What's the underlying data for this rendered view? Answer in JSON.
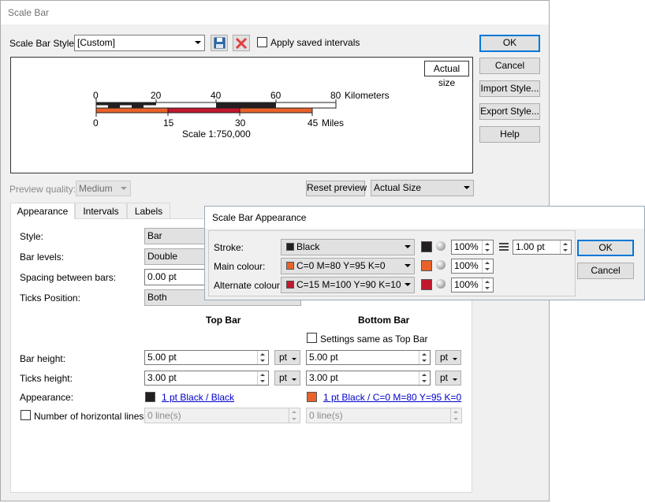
{
  "window": {
    "title": "Scale Bar"
  },
  "style_row": {
    "label": "Scale Bar Style:",
    "value": "[Custom]",
    "apply_saved_label": "Apply saved intervals"
  },
  "side_buttons": {
    "ok": "OK",
    "cancel": "Cancel",
    "import": "Import Style...",
    "export": "Export Style...",
    "help": "Help"
  },
  "preview": {
    "actual_size_tag": "Actual size",
    "km_ticks": [
      "0",
      "20",
      "40",
      "60",
      "80"
    ],
    "km_unit": "Kilometers",
    "mile_ticks": [
      "0",
      "15",
      "30",
      "45"
    ],
    "mile_unit": "Miles",
    "scale_text": "Scale 1:750,000",
    "colors": {
      "black": "#231f20",
      "main": "#e8622a",
      "alternate": "#c0182e"
    }
  },
  "preview_row": {
    "quality_label": "Preview quality:",
    "quality_value": "Medium",
    "reset_label": "Reset preview",
    "size_value": "Actual Size"
  },
  "tabs": [
    "Appearance",
    "Intervals",
    "Labels"
  ],
  "appearance": {
    "style_label": "Style:",
    "style_value": "Bar",
    "levels_label": "Bar levels:",
    "levels_value": "Double",
    "spacing_label": "Spacing between bars:",
    "spacing_value": "0.00 pt",
    "ticks_label": "Ticks Position:",
    "ticks_value": "Both",
    "top_bar_header": "Top Bar",
    "bottom_bar_header": "Bottom Bar",
    "same_settings_label": "Settings same as Top Bar",
    "bar_height_label": "Bar height:",
    "top_bar_height": "5.00 pt",
    "bottom_bar_height": "5.00 pt",
    "ticks_height_label": "Ticks height:",
    "top_ticks_height": "3.00 pt",
    "bottom_ticks_height": "3.00 pt",
    "unit": "pt",
    "appearance_label": "Appearance:",
    "top_appearance_link": "1 pt Black / Black",
    "bottom_appearance_link": "1 pt Black / C=0 M=80 Y=95 K=0",
    "hlines_label": "Number of horizontal lines:",
    "top_hlines": "0 line(s)",
    "bottom_hlines": "0 line(s)"
  },
  "popup": {
    "title": "Scale Bar Appearance",
    "stroke_label": "Stroke:",
    "stroke_value": "Black",
    "stroke_pct": "100%",
    "stroke_width": "1.00 pt",
    "main_label": "Main colour:",
    "main_value": "C=0 M=80 Y=95 K=0",
    "main_pct": "100%",
    "alt_label": "Alternate colour:",
    "alt_value": "C=15 M=100 Y=90 K=10",
    "alt_pct": "100%",
    "ok": "OK",
    "cancel": "Cancel"
  }
}
